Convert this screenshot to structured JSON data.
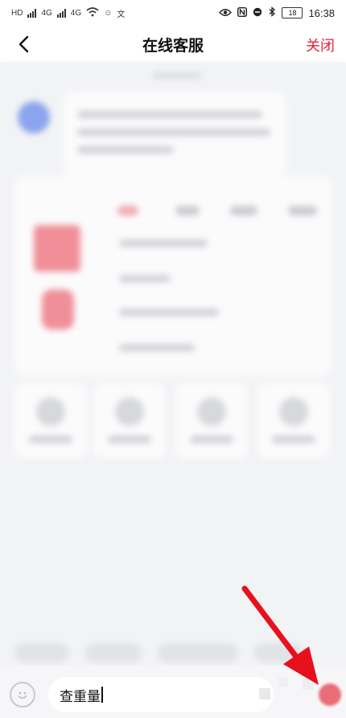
{
  "status_bar": {
    "left_labels": [
      "HD",
      "4G",
      "4G"
    ],
    "battery": "18",
    "time": "16:38"
  },
  "header": {
    "title": "在线客服",
    "close_label": "关闭"
  },
  "input": {
    "value": "查重量"
  },
  "colors": {
    "accent": "#e0243c",
    "annotation_arrow": "#e8101c"
  },
  "icons": [
    "back-icon",
    "eye-icon",
    "nfc-icon",
    "mute-icon",
    "bluetooth-icon",
    "battery-icon",
    "wifi-icon",
    "emoji-icon",
    "send-icon"
  ]
}
